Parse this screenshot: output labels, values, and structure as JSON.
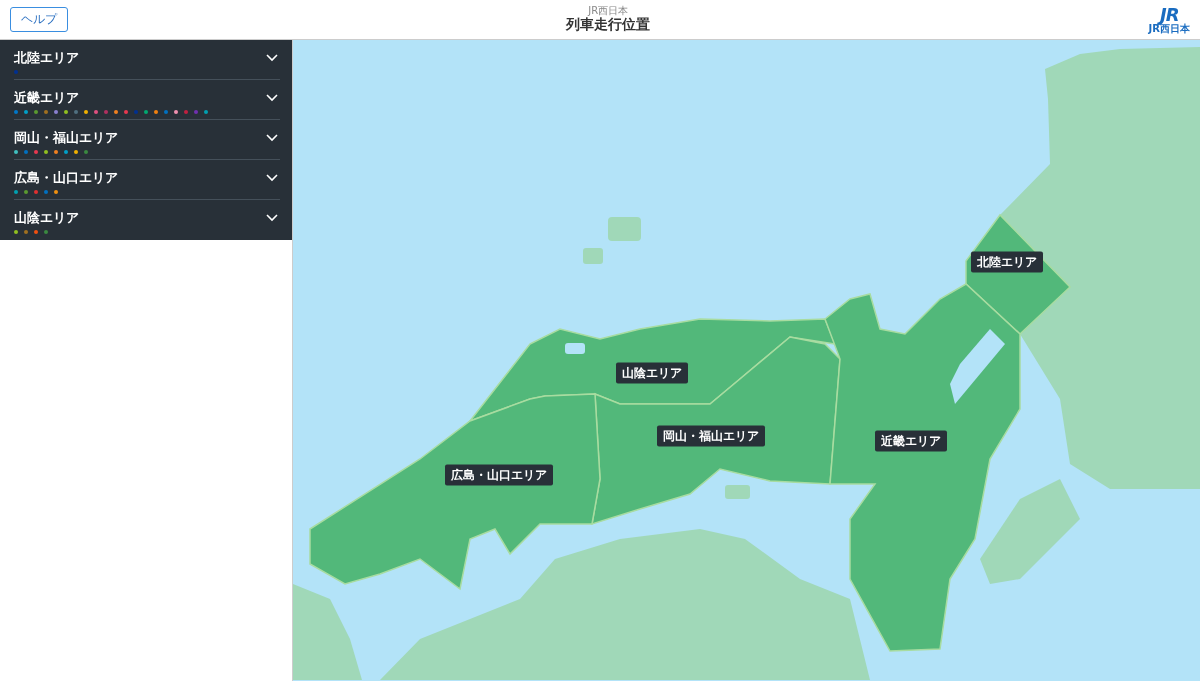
{
  "header": {
    "help_button": "ヘルプ",
    "subtitle": "JR西日本",
    "title": "列車走行位置",
    "logo": {
      "mark": "JR",
      "caption": "JR西日本"
    }
  },
  "areas": [
    {
      "name": "北陸エリア",
      "lines": [
        {
          "color": "#003090"
        }
      ]
    },
    {
      "name": "近畿エリア",
      "lines": [
        {
          "color": "#0077c8"
        },
        {
          "color": "#00a0c8"
        },
        {
          "color": "#5a9a30"
        },
        {
          "color": "#a07020"
        },
        {
          "color": "#8a80d0"
        },
        {
          "color": "#90c020"
        },
        {
          "color": "#507080"
        },
        {
          "color": "#f0b000"
        },
        {
          "color": "#e05080"
        },
        {
          "color": "#b03060"
        },
        {
          "color": "#f08020"
        },
        {
          "color": "#e83850"
        },
        {
          "color": "#003090"
        },
        {
          "color": "#00a870"
        },
        {
          "color": "#f08010"
        },
        {
          "color": "#0070c0"
        },
        {
          "color": "#f090b0"
        },
        {
          "color": "#c02040"
        },
        {
          "color": "#7030b0"
        },
        {
          "color": "#00a0b0"
        }
      ]
    },
    {
      "name": "岡山・福山エリア",
      "lines": [
        {
          "color": "#40c0c0"
        },
        {
          "color": "#0070c0"
        },
        {
          "color": "#e83850"
        },
        {
          "color": "#90c020"
        },
        {
          "color": "#f08020"
        },
        {
          "color": "#00a0c8"
        },
        {
          "color": "#f0b000"
        },
        {
          "color": "#3a8a40"
        }
      ]
    },
    {
      "name": "広島・山口エリア",
      "lines": [
        {
          "color": "#00a0b0"
        },
        {
          "color": "#5a9a30"
        },
        {
          "color": "#e03030"
        },
        {
          "color": "#0070c0"
        },
        {
          "color": "#f09010"
        }
      ]
    },
    {
      "name": "山陰エリア",
      "lines": [
        {
          "color": "#90c020"
        },
        {
          "color": "#a07020"
        },
        {
          "color": "#f05010"
        },
        {
          "color": "#3a8a40"
        }
      ]
    }
  ],
  "map": {
    "labels": [
      "北陸エリア",
      "山陰エリア",
      "岡山・福山エリア",
      "近畿エリア",
      "広島・山口エリア"
    ]
  }
}
